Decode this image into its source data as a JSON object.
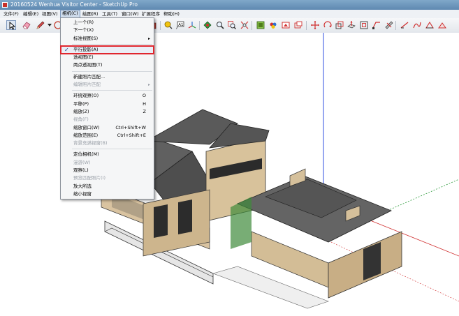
{
  "window": {
    "title": "20160524 Wenhua Visitor Center - SketchUp Pro"
  },
  "menubar": [
    {
      "label": "文件(F)",
      "open": false
    },
    {
      "label": "编辑(E)",
      "open": false
    },
    {
      "label": "视图(V)",
      "open": false
    },
    {
      "label": "相机(C)",
      "open": true
    },
    {
      "label": "绘图(R)",
      "open": false
    },
    {
      "label": "工具(T)",
      "open": false
    },
    {
      "label": "窗口(W)",
      "open": false
    },
    {
      "label": "扩展程序",
      "open": false
    },
    {
      "label": "帮助(H)",
      "open": false
    }
  ],
  "camera_menu": {
    "items": [
      {
        "type": "item",
        "label": "上一个(R)",
        "shortcut": "",
        "submenu": false,
        "disabled": false,
        "checked": false,
        "highlight": false
      },
      {
        "type": "item",
        "label": "下一个(X)",
        "shortcut": "",
        "submenu": false,
        "disabled": false,
        "checked": false,
        "highlight": false
      },
      {
        "type": "item",
        "label": "标准视图(S)",
        "shortcut": "",
        "submenu": true,
        "disabled": false,
        "checked": false,
        "highlight": false
      },
      {
        "type": "sep"
      },
      {
        "type": "item",
        "label": "平行投影(A)",
        "shortcut": "",
        "submenu": false,
        "disabled": false,
        "checked": true,
        "highlight": true
      },
      {
        "type": "item",
        "label": "透视图(E)",
        "shortcut": "",
        "submenu": false,
        "disabled": false,
        "checked": false,
        "highlight": false
      },
      {
        "type": "item",
        "label": "两点透视图(T)",
        "shortcut": "",
        "submenu": false,
        "disabled": false,
        "checked": false,
        "highlight": false
      },
      {
        "type": "sep"
      },
      {
        "type": "item",
        "label": "新建照片匹配...",
        "shortcut": "",
        "submenu": false,
        "disabled": false,
        "checked": false,
        "highlight": false
      },
      {
        "type": "item",
        "label": "编辑照片匹配",
        "shortcut": "",
        "submenu": true,
        "disabled": true,
        "checked": false,
        "highlight": false
      },
      {
        "type": "sep"
      },
      {
        "type": "item",
        "label": "环绕观察(O)",
        "shortcut": "O",
        "submenu": false,
        "disabled": false,
        "checked": false,
        "highlight": false
      },
      {
        "type": "item",
        "label": "平移(P)",
        "shortcut": "H",
        "submenu": false,
        "disabled": false,
        "checked": false,
        "highlight": false
      },
      {
        "type": "item",
        "label": "缩放(Z)",
        "shortcut": "Z",
        "submenu": false,
        "disabled": false,
        "checked": false,
        "highlight": false
      },
      {
        "type": "item",
        "label": "视角(F)",
        "shortcut": "",
        "submenu": false,
        "disabled": true,
        "checked": false,
        "highlight": false
      },
      {
        "type": "item",
        "label": "缩放窗口(W)",
        "shortcut": "Ctrl+Shift+W",
        "submenu": false,
        "disabled": false,
        "checked": false,
        "highlight": false
      },
      {
        "type": "item",
        "label": "缩放范围(E)",
        "shortcut": "Ctrl+Shift+E",
        "submenu": false,
        "disabled": false,
        "checked": false,
        "highlight": false
      },
      {
        "type": "item",
        "label": "背景充满视窗(B)",
        "shortcut": "",
        "submenu": false,
        "disabled": true,
        "checked": false,
        "highlight": false
      },
      {
        "type": "sep"
      },
      {
        "type": "item",
        "label": "定位相机(M)",
        "shortcut": "",
        "submenu": false,
        "disabled": false,
        "checked": false,
        "highlight": false
      },
      {
        "type": "item",
        "label": "漫游(W)",
        "shortcut": "",
        "submenu": false,
        "disabled": true,
        "checked": false,
        "highlight": false
      },
      {
        "type": "item",
        "label": "观察(L)",
        "shortcut": "",
        "submenu": false,
        "disabled": false,
        "checked": false,
        "highlight": false
      },
      {
        "type": "item",
        "label": "预览匹配照片(I)",
        "shortcut": "",
        "submenu": false,
        "disabled": true,
        "checked": false,
        "highlight": false
      },
      {
        "type": "item",
        "label": "放大所选",
        "shortcut": "",
        "submenu": false,
        "disabled": false,
        "checked": false,
        "highlight": false
      },
      {
        "type": "item",
        "label": "缩小视窗",
        "shortcut": "",
        "submenu": false,
        "disabled": false,
        "checked": false,
        "highlight": false
      }
    ],
    "check_glyph": "✓",
    "submenu_glyph": "▸"
  },
  "toolbar_icons": [
    "select-arrow-icon",
    "eraser-icon",
    "pencil-line-icon",
    "dropdown-icon",
    "orbit-icon",
    "paint-bucket-icon",
    "tape-measure-icon",
    "text-label-icon",
    "axes-icon",
    "section-plane-icon",
    "zoom-icon",
    "zoom-extents-icon",
    "components-icon",
    "paint-materials-icon",
    "styles-icon",
    "move-icon",
    "rotate-icon",
    "scale-icon",
    "push-pull-icon",
    "offset-icon",
    "follow-me-icon",
    "intersect-icon",
    "tag-icon",
    "sandbox-icon",
    "arc-icon",
    "freehand-icon",
    "protractor-icon"
  ],
  "colors": {
    "menu_highlight_outline": "#e0262e",
    "check_color": "#1c3f86"
  }
}
